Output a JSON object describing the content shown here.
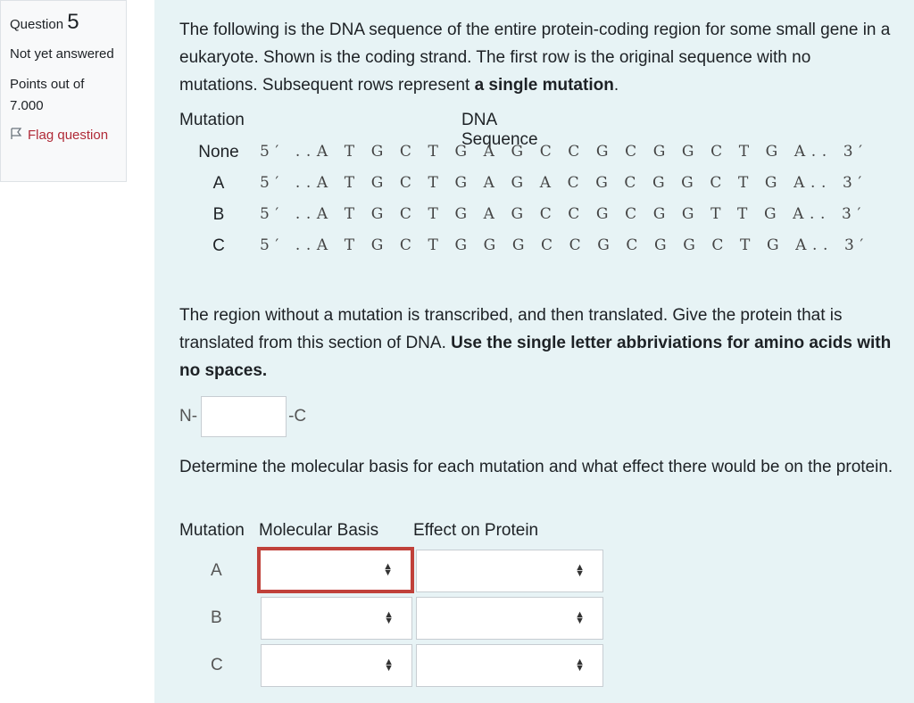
{
  "info": {
    "question_label": "Question",
    "question_number": "5",
    "state": "Not yet answered",
    "grade": "Points out of 7.000",
    "flag_label": "Flag question"
  },
  "question": {
    "intro": "The following is the DNA sequence of the entire protein-coding region for some small gene in a eukaryote. Shown is the coding strand. The first row is the original sequence with no mutations. Subsequent rows represent ",
    "intro_bold": "a single mutation",
    "intro_end": ".",
    "table_head_mutation": "Mutation",
    "table_head_dna": "DNA Sequence",
    "rows": [
      {
        "label": "None",
        "seq": "5′ ..A T G C T G A G C C G C G G C T G A.. 3′"
      },
      {
        "label": "A",
        "seq": "5′ ..A T G C T G A G A C G C G G C T G A.. 3′"
      },
      {
        "label": "B",
        "seq": "5′ ..A T G C T G A G C C G C G G T T G A.. 3′"
      },
      {
        "label": "C",
        "seq": "5′ ..A T G C T G G G C C G C G G C T G A.. 3′"
      }
    ],
    "q2_text": "The region without a mutation is transcribed, and then translated.  Give the protein that is translated from this section of DNA. ",
    "q2_bold": "Use the single letter abbriviations for amino acids with no spaces.",
    "n_term": "N-",
    "c_term": "-C",
    "answer_value": "",
    "q3_text": "Determine the molecular basis for each mutation and what effect there would be on the protein.",
    "mut_head_mutation": "Mutation",
    "mut_head_basis": "Molecular Basis",
    "mut_head_effect": "Effect on Protein",
    "mut_rows": [
      {
        "label": "A",
        "basis": "",
        "effect": ""
      },
      {
        "label": "B",
        "basis": "",
        "effect": ""
      },
      {
        "label": "C",
        "basis": "",
        "effect": ""
      }
    ]
  },
  "colors": {
    "panel_bg": "#e7f3f5",
    "flag_text": "#b02a37",
    "focus_border": "#c0413a"
  },
  "icons": {
    "flag": "flag-icon",
    "select": "up-down-arrows-icon"
  }
}
